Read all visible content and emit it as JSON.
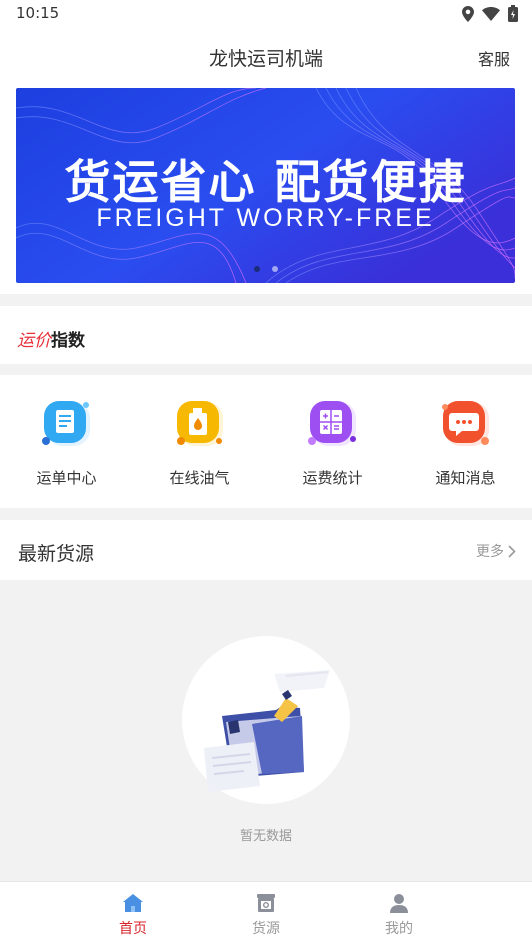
{
  "status_bar": {
    "time": "10:15",
    "icons": [
      "location-icon",
      "wifi-icon",
      "battery-icon"
    ]
  },
  "header": {
    "title": "龙快运司机端",
    "service_label": "客服"
  },
  "banner": {
    "headline": "货运省心 配货便捷",
    "subline": "FREIGHT WORRY-FREE",
    "slide_count": 2,
    "active_slide": 1
  },
  "price_index": {
    "part1": "运价",
    "part2": "指数"
  },
  "quick_menu": [
    {
      "label": "运单中心",
      "icon": "waybill-icon",
      "color": "#2fa8f0"
    },
    {
      "label": "在线油气",
      "icon": "fuel-icon",
      "color": "#f5b400"
    },
    {
      "label": "运费统计",
      "icon": "calculator-icon",
      "color": "#9b4ff0"
    },
    {
      "label": "通知消息",
      "icon": "message-icon",
      "color": "#f04e2c"
    }
  ],
  "latest": {
    "title": "最新货源",
    "more_label": "更多"
  },
  "empty_state": {
    "text": "暂无数据"
  },
  "tabbar": {
    "items": [
      {
        "label": "首页",
        "icon": "home-icon",
        "active": true
      },
      {
        "label": "货源",
        "icon": "cargo-icon",
        "active": false
      },
      {
        "label": "我的",
        "icon": "user-icon",
        "active": false
      }
    ]
  },
  "colors": {
    "accent": "#d8262d",
    "banner_blue": "#1f3fd6",
    "icon_blue": "#4a90e2"
  }
}
